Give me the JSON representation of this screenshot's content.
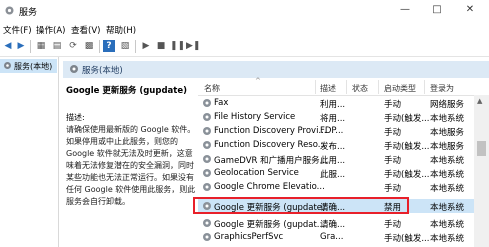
{
  "window": {
    "title": "服务"
  },
  "menu": [
    "文件(F)",
    "操作(A)",
    "查看(V)",
    "帮助(H)"
  ],
  "tree": {
    "item": "服务(本地)"
  },
  "pane_header": "服务(本地)",
  "description": {
    "title": "Google 更新服务 (gupdate)",
    "label": "描述:",
    "lines": [
      "请确保使用最新版的 Google 软件。",
      "如果停用或中止此服务，则您的",
      "Google 软件就无法及时更新，这意",
      "味着无法修复潜在的安全漏洞，同时",
      "某些功能也无法正常运行。如果没有",
      "任何 Google 软件使用此服务，则此",
      "服务会自行卸载。"
    ]
  },
  "columns": {
    "name": "名称",
    "desc": "描述",
    "status": "状态",
    "startup": "启动类型",
    "logon": "登录为"
  },
  "rows": [
    {
      "name": "Fax",
      "desc": "利用...",
      "status": "",
      "startup": "手动",
      "logon": "网络服务"
    },
    {
      "name": "File History Service",
      "desc": "将用...",
      "status": "",
      "startup": "手动(触发...",
      "logon": "本地系统"
    },
    {
      "name": "Function Discovery Provi...",
      "desc": "FDP...",
      "status": "",
      "startup": "手动",
      "logon": "本地服务"
    },
    {
      "name": "Function Discovery Reso...",
      "desc": "发布...",
      "status": "",
      "startup": "手动(触发...",
      "logon": "本地服务"
    },
    {
      "name": "GameDVR 和广播用户服务...",
      "desc": "此用...",
      "status": "",
      "startup": "手动",
      "logon": "本地系统"
    },
    {
      "name": "Geolocation Service",
      "desc": "此服...",
      "status": "",
      "startup": "手动(触发...",
      "logon": "本地系统"
    },
    {
      "name": "Google Chrome Elevatio...",
      "desc": "",
      "status": "",
      "startup": "手动",
      "logon": "本地系统"
    },
    {
      "name": "Google 更新服务 (gupdate)",
      "desc": "请确...",
      "status": "",
      "startup": "禁用",
      "logon": "本地系统"
    },
    {
      "name": "Google 更新服务 (gupdat...",
      "desc": "请确...",
      "status": "",
      "startup": "手动",
      "logon": "本地系统"
    },
    {
      "name": "GraphicsPerfSvc",
      "desc": "Gra...",
      "status": "",
      "startup": "手动(触发...",
      "logon": "本地系统"
    }
  ],
  "colors": {
    "selection": "#cce4f7",
    "highlight": "#e8202a",
    "header_band": "#dce9f5"
  }
}
